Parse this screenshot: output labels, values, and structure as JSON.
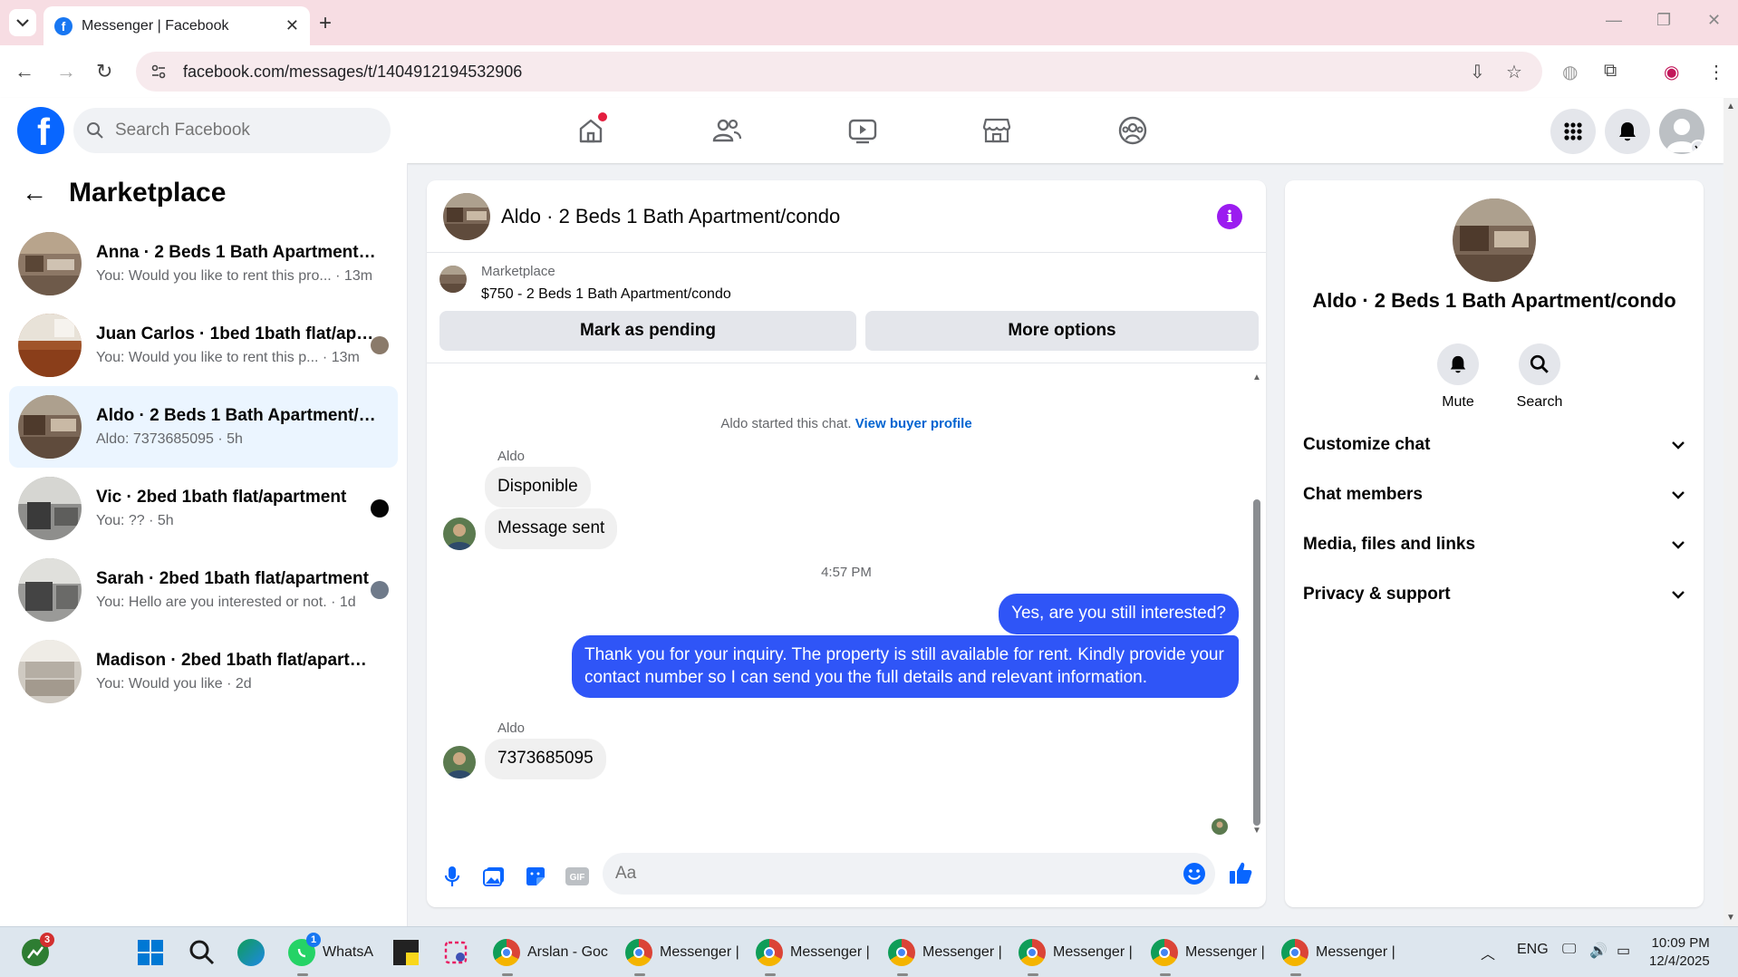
{
  "browser": {
    "tab_title": "Messenger | Facebook",
    "url": "facebook.com/messages/t/1404912194532906"
  },
  "fb": {
    "search_placeholder": "Search Facebook"
  },
  "left": {
    "title": "Marketplace",
    "conversations": [
      {
        "name": "Anna · 2 Beds 1 Bath Apartment/c...",
        "sub": "You: Would you like to rent this pro... · 13m"
      },
      {
        "name": "Juan Carlos · 1bed 1bath flat/apa...",
        "sub": "You: Would you like to rent this p... · 13m"
      },
      {
        "name": "Aldo · 2 Beds 1 Bath Apartment/co...",
        "sub": "Aldo: 7373685095 · 5h"
      },
      {
        "name": "Vic · 2bed 1bath flat/apartment",
        "sub": "You: ?? · 5h"
      },
      {
        "name": "Sarah · 2bed 1bath flat/apartment",
        "sub": "You: Hello are you interested or not. · 1d"
      },
      {
        "name": "Madison · 2bed 1bath flat/apartm...",
        "sub": "You: Would you like · 2d"
      }
    ]
  },
  "chat": {
    "title": "Aldo · 2 Beds 1 Bath Apartment/condo",
    "marketplace_label": "Marketplace",
    "listing": "$750 - 2 Beds 1 Bath Apartment/condo",
    "pending_btn": "Mark as pending",
    "more_btn": "More options",
    "started_text": "Aldo started this chat.",
    "buyer_link": "View buyer profile",
    "sender": "Aldo",
    "msg1": "Disponible",
    "msg2": "Message sent",
    "time": "4:57 PM",
    "out1": "Yes, are you still interested?",
    "out2": "Thank you for your inquiry. The property is still available for rent. Kindly provide your contact number so I can send you the full details and relevant information.",
    "msg3": "7373685095",
    "composer_placeholder": "Aa"
  },
  "right": {
    "title": "Aldo · 2 Beds 1 Bath Apartment/condo",
    "mute": "Mute",
    "search": "Search",
    "sections": [
      "Customize chat",
      "Chat members",
      "Media, files and links",
      "Privacy & support"
    ]
  },
  "taskbar": {
    "whatsapp": "WhatsA",
    "arslan": "Arslan - Goc",
    "messenger": "Messenger |",
    "lang": "ENG",
    "time": "10:09 PM",
    "date": "12/4/2025",
    "badge_wa": "1",
    "badge_app": "3"
  }
}
